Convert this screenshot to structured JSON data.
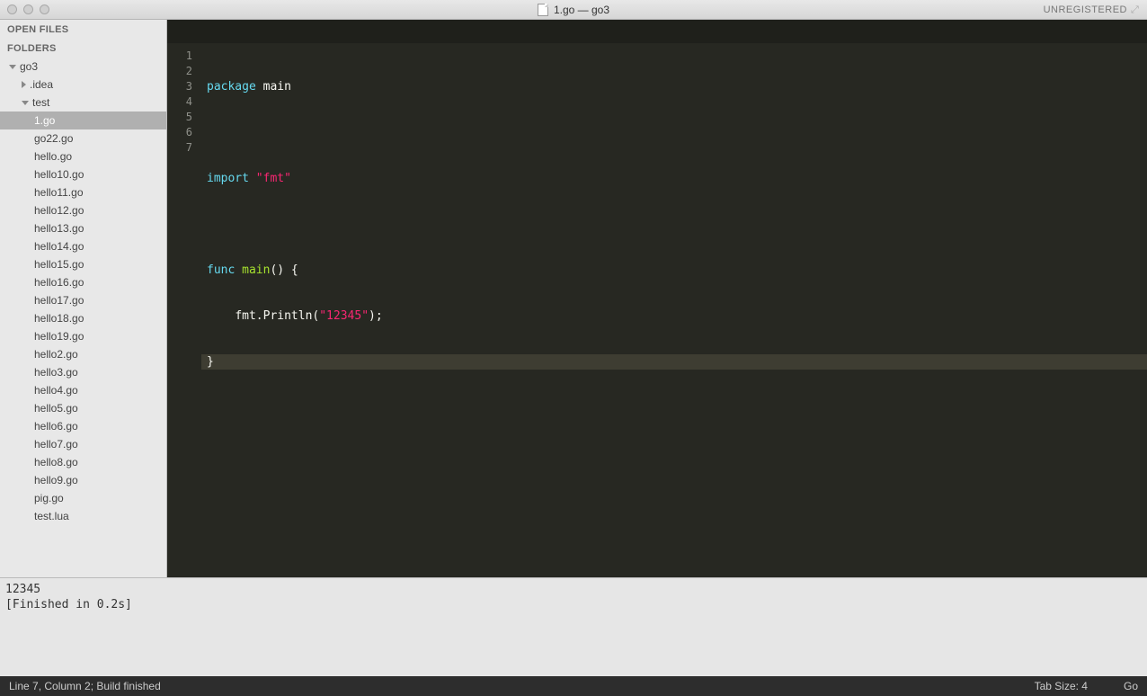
{
  "titlebar": {
    "title": "1.go — go3",
    "unregistered": "UNREGISTERED"
  },
  "sidebar": {
    "open_files": "OPEN FILES",
    "folders": "FOLDERS",
    "root": "go3",
    "items": [
      {
        "label": ".idea",
        "depth": 1,
        "arrow": "right"
      },
      {
        "label": "test",
        "depth": 1,
        "arrow": "down"
      },
      {
        "label": "1.go",
        "depth": 2,
        "selected": true
      },
      {
        "label": "go22.go",
        "depth": 2
      },
      {
        "label": "hello.go",
        "depth": 2
      },
      {
        "label": "hello10.go",
        "depth": 2
      },
      {
        "label": "hello11.go",
        "depth": 2
      },
      {
        "label": "hello12.go",
        "depth": 2
      },
      {
        "label": "hello13.go",
        "depth": 2
      },
      {
        "label": "hello14.go",
        "depth": 2
      },
      {
        "label": "hello15.go",
        "depth": 2
      },
      {
        "label": "hello16.go",
        "depth": 2
      },
      {
        "label": "hello17.go",
        "depth": 2
      },
      {
        "label": "hello18.go",
        "depth": 2
      },
      {
        "label": "hello19.go",
        "depth": 2
      },
      {
        "label": "hello2.go",
        "depth": 2
      },
      {
        "label": "hello3.go",
        "depth": 2
      },
      {
        "label": "hello4.go",
        "depth": 2
      },
      {
        "label": "hello5.go",
        "depth": 2
      },
      {
        "label": "hello6.go",
        "depth": 2
      },
      {
        "label": "hello7.go",
        "depth": 2
      },
      {
        "label": "hello8.go",
        "depth": 2
      },
      {
        "label": "hello9.go",
        "depth": 2
      },
      {
        "label": "pig.go",
        "depth": 2
      },
      {
        "label": "test.lua",
        "depth": 2
      }
    ]
  },
  "editor": {
    "lines": [
      "1",
      "2",
      "3",
      "4",
      "5",
      "6",
      "7"
    ],
    "code": {
      "l1_kw": "package",
      "l1_name": " main",
      "l3_kw": "import",
      "l3_str": " \"fmt\"",
      "l5_kw": "func",
      "l5_name": " main",
      "l5_rest": "() {",
      "l6_indent": "    ",
      "l6_call": "fmt.Println(",
      "l6_str": "\"12345\"",
      "l6_end": ");",
      "l7": "}"
    }
  },
  "output": {
    "line1": "12345",
    "line2": "[Finished in 0.2s]"
  },
  "status": {
    "left": "Line 7, Column 2; Build finished",
    "tabsize": "Tab Size: 4",
    "lang": "Go"
  }
}
